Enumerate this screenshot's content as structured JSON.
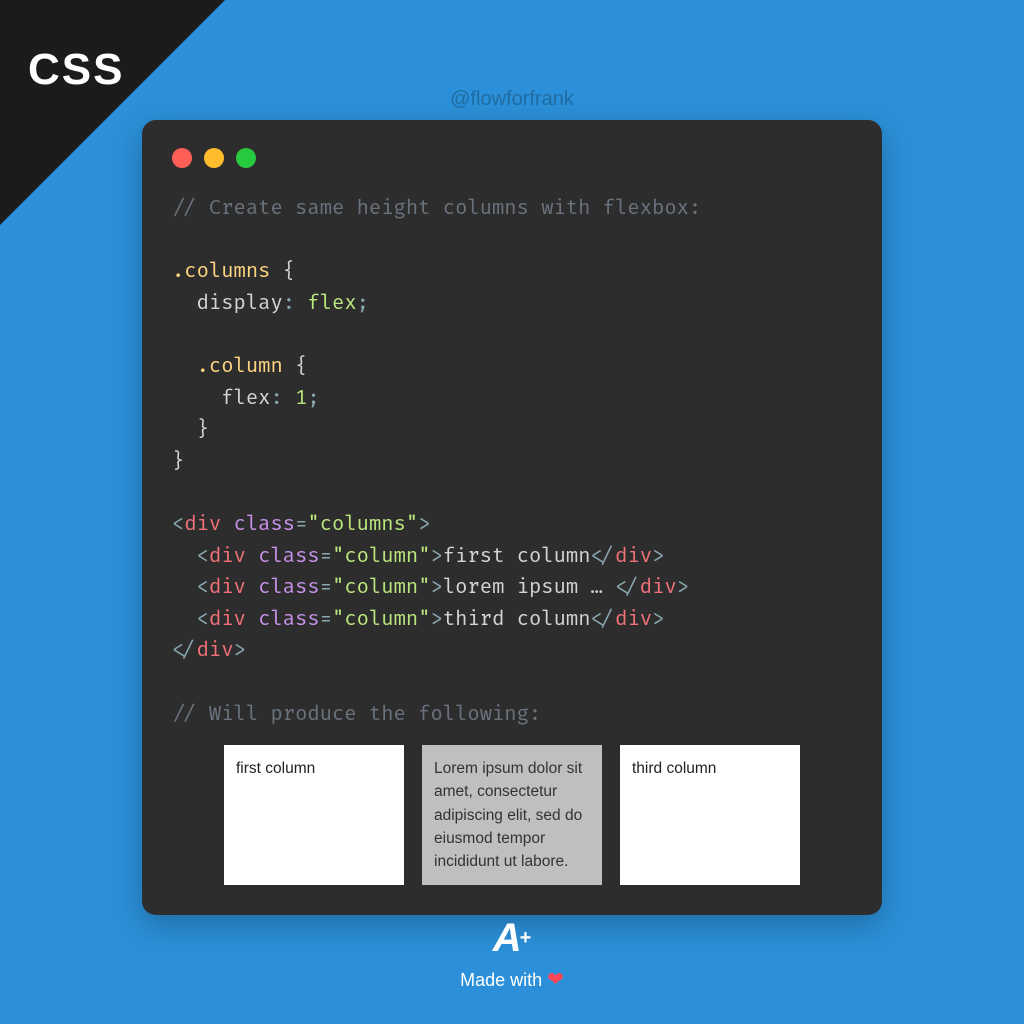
{
  "corner_label": "CSS",
  "handle": "@flowforfrank",
  "code": {
    "comment1": "// Create same height columns with flexbox:",
    "sel_columns": ".columns",
    "prop_display": "display",
    "val_flex": "flex",
    "sel_column": ".column",
    "prop_flex": "flex",
    "val_one": "1",
    "tag_div": "div",
    "attr_class": "class",
    "val_columns": "columns",
    "val_column": "column",
    "txt_first": "first column",
    "txt_lorem": "lorem ipsum …",
    "txt_third": "third column",
    "comment2": "// Will produce the following:"
  },
  "demo": {
    "col1": "first column",
    "col2": "Lorem ipsum dolor sit amet, consectetur adipiscing elit, sed do eiusmod tempor incididunt ut labore.",
    "col3": "third column"
  },
  "footer": {
    "logo_a": "A",
    "logo_plus": "+",
    "made_with": "Made with",
    "heart": "❤"
  }
}
